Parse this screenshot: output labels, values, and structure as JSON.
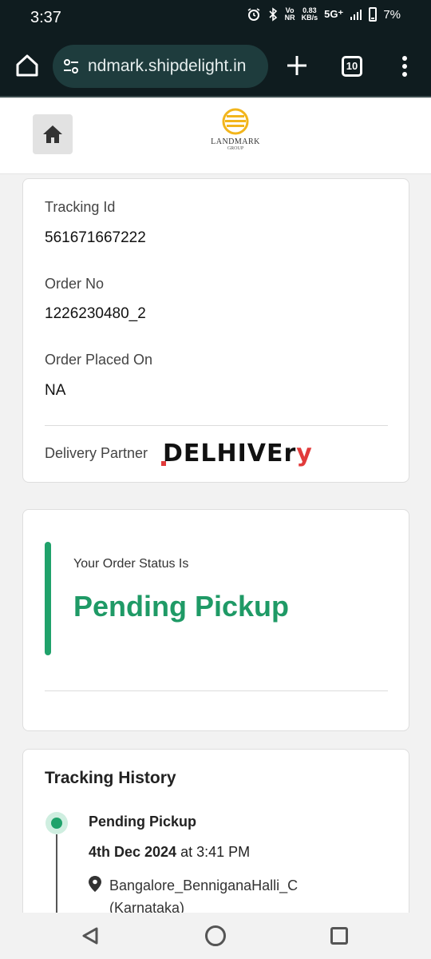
{
  "status_bar": {
    "time": "3:37",
    "network_top": "Vo",
    "network_bottom": "NR",
    "speed_top": "0.83",
    "speed_bottom": "KB/s",
    "signal": "5G⁺",
    "battery": "7%"
  },
  "browser": {
    "url": "ndmark.shipdelight.in",
    "tab_count": "10"
  },
  "header": {
    "logo_name": "LANDMARK",
    "logo_sub": "GROUP"
  },
  "order": {
    "tracking_id_label": "Tracking Id",
    "tracking_id": "561671667222",
    "order_no_label": "Order No",
    "order_no": "1226230480_2",
    "placed_on_label": "Order Placed On",
    "placed_on": "NA",
    "partner_label": "Delivery Partner",
    "partner_logo_main": "DELHIVEr",
    "partner_logo_end": "y"
  },
  "status": {
    "label": "Your Order Status Is",
    "value": "Pending Pickup"
  },
  "history": {
    "title": "Tracking History",
    "events": [
      {
        "status": "Pending Pickup",
        "date": "4th Dec 2024",
        "time_prefix": " at ",
        "time": "3:41 PM",
        "location": "Bangalore_BenniganaHalli_C (Karnataka)"
      }
    ]
  },
  "colors": {
    "accent_green": "#20a26b",
    "logo_gold": "#f2b51c",
    "delhivery_red": "#e13b3b"
  }
}
